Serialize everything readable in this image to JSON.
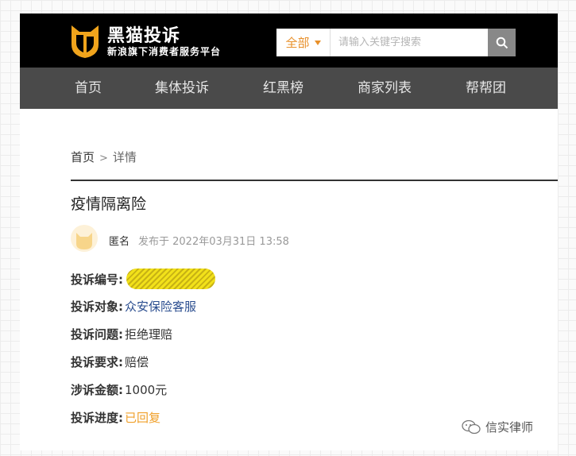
{
  "header": {
    "brand_title": "黑猫投诉",
    "brand_subtitle": "新浪旗下消费者服务平台",
    "search": {
      "scope": "全部",
      "placeholder": "请输入关键字搜索"
    }
  },
  "nav": {
    "items": [
      "首页",
      "集体投诉",
      "红黑榜",
      "商家列表",
      "帮帮团"
    ]
  },
  "breadcrumb": {
    "home": "首页",
    "separator": ">",
    "current": "详情"
  },
  "complaint": {
    "title": "疫情隔离险",
    "author": "匿名",
    "posted": "发布于 2022年03月31日 13:58",
    "fields": {
      "id_label": "投诉编号:",
      "target_label": "投诉对象:",
      "target_value": "众安保险客服",
      "issue_label": "投诉问题:",
      "issue_value": "拒绝理赔",
      "request_label": "投诉要求:",
      "request_value": "赔偿",
      "amount_label": "涉诉金额:",
      "amount_value": "1000元",
      "progress_label": "投诉进度:",
      "progress_value": "已回复"
    }
  },
  "watermark": "信实律师",
  "colors": {
    "header_bg": "#000000",
    "nav_bg": "#4a4a4a",
    "accent": "#e8902a",
    "link": "#2a4d8f",
    "status": "#f0a02a"
  }
}
